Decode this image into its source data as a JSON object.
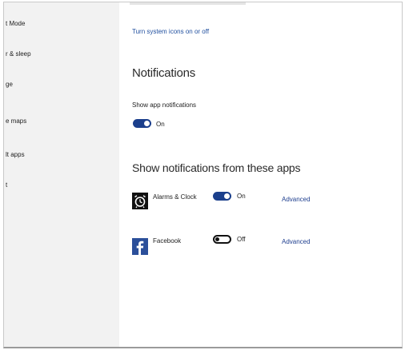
{
  "sidebar": {
    "items": [
      {
        "label": "t Mode"
      },
      {
        "label": "r & sleep"
      },
      {
        "label": "ge"
      },
      {
        "label": "e maps"
      },
      {
        "label": "lt apps"
      },
      {
        "label": "t"
      }
    ]
  },
  "main": {
    "system_icons_link": "Turn system icons on or off",
    "notifications_heading": "Notifications",
    "show_app_notifications_label": "Show app notifications",
    "show_app_notifications_state": "On",
    "apps_heading": "Show notifications from these apps",
    "apps": [
      {
        "name": "Alarms & Clock",
        "icon": "alarm-clock-icon",
        "toggle_state": "On",
        "advanced": "Advanced"
      },
      {
        "name": "Facebook",
        "icon": "facebook-icon",
        "toggle_state": "Off",
        "advanced": "Advanced"
      }
    ]
  },
  "colors": {
    "accent": "#1b3f8c",
    "link": "#1f4e9e",
    "sidebar_bg": "#f2f2f2"
  }
}
